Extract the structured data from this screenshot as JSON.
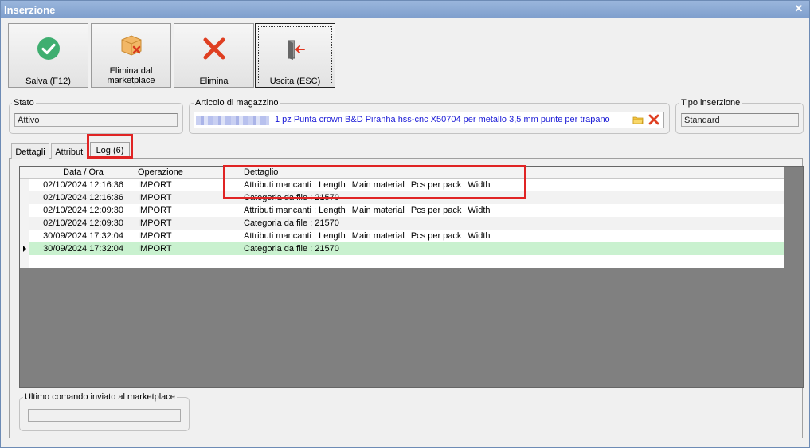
{
  "window": {
    "title": "Inserzione",
    "close_icon": "close-icon"
  },
  "toolbar": {
    "save_label": "Salva (F12)",
    "delete_marketplace_line1": "Elimina dal",
    "delete_marketplace_line2": "marketplace",
    "delete_label": "Elimina",
    "exit_label": "Uscita (ESC)"
  },
  "status": {
    "legend": "Stato",
    "value": "Attivo"
  },
  "article": {
    "legend": "Articolo di magazzino",
    "value": "1 pz Punta crown B&D Piranha hss-cnc X50704 per metallo 3,5 mm punte per trapano"
  },
  "insertion_type": {
    "legend": "Tipo inserzione",
    "value": "Standard"
  },
  "tabs": [
    {
      "label": "Dettagli"
    },
    {
      "label": "Attributi"
    },
    {
      "label": "Log (6)"
    }
  ],
  "log_grid": {
    "columns": [
      "Data / Ora",
      "Operazione",
      "Dettaglio"
    ],
    "rows": [
      {
        "datetime": "02/10/2024 12:16:36",
        "operation": "IMPORT",
        "detail": [
          "Attributi mancanti : Length",
          "Main material",
          "Pcs per pack",
          "Width"
        ]
      },
      {
        "datetime": "02/10/2024 12:16:36",
        "operation": "IMPORT",
        "detail": [
          "Categoria da file : 21570"
        ]
      },
      {
        "datetime": "02/10/2024 12:09:30",
        "operation": "IMPORT",
        "detail": [
          "Attributi mancanti : Length",
          "Main material",
          "Pcs per pack",
          "Width"
        ]
      },
      {
        "datetime": "02/10/2024 12:09:30",
        "operation": "IMPORT",
        "detail": [
          "Categoria da file : 21570"
        ]
      },
      {
        "datetime": "30/09/2024 17:32:04",
        "operation": "IMPORT",
        "detail": [
          "Attributi mancanti : Length",
          "Main material",
          "Pcs per pack",
          "Width"
        ]
      },
      {
        "datetime": "30/09/2024 17:32:04",
        "operation": "IMPORT",
        "detail": [
          "Categoria da file : 21570"
        ]
      }
    ],
    "current_row_color": "#c9f1cf"
  },
  "last_command": {
    "legend": "Ultimo comando inviato al marketplace",
    "value": ""
  },
  "colors": {
    "highlight_red": "#e02424",
    "link_blue": "#1a1ad6",
    "title_bar": "#8aa8d4"
  }
}
